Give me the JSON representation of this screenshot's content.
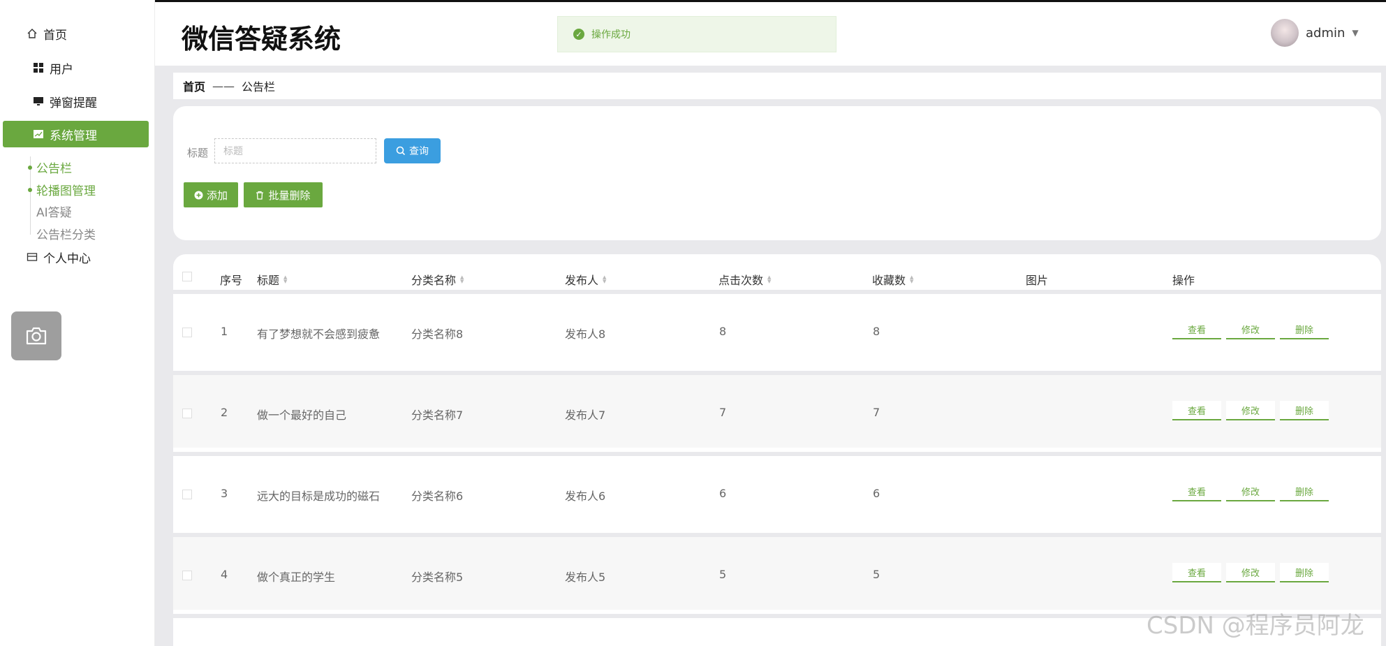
{
  "app": {
    "title": "微信答疑系统"
  },
  "toast": {
    "text": "操作成功"
  },
  "user": {
    "name": "admin"
  },
  "sidebar": {
    "items": [
      {
        "label": "首页",
        "icon": "home-icon"
      },
      {
        "label": "用户",
        "icon": "grid-icon"
      },
      {
        "label": "弹窗提醒",
        "icon": "monitor-icon"
      },
      {
        "label": "系统管理",
        "icon": "chart-icon"
      },
      {
        "label": "个人中心",
        "icon": "card-icon"
      }
    ],
    "submenu": [
      "公告栏",
      "轮播图管理",
      "AI答疑",
      "公告栏分类"
    ]
  },
  "breadcrumb": {
    "home": "首页",
    "sep": "——",
    "current": "公告栏"
  },
  "search": {
    "label": "标题",
    "placeholder": "标题",
    "button": "查询"
  },
  "actions": {
    "add": "添加",
    "bulk_delete": "批量删除"
  },
  "table": {
    "headers": [
      "序号",
      "标题",
      "分类名称",
      "发布人",
      "点击次数",
      "收藏数",
      "图片",
      "操作"
    ],
    "rows": [
      {
        "no": "1",
        "title": "有了梦想就不会感到疲惫",
        "category": "分类名称8",
        "publisher": "发布人8",
        "clicks": "8",
        "favorites": "8"
      },
      {
        "no": "2",
        "title": "做一个最好的自己",
        "category": "分类名称7",
        "publisher": "发布人7",
        "clicks": "7",
        "favorites": "7"
      },
      {
        "no": "3",
        "title": "远大的目标是成功的磁石",
        "category": "分类名称6",
        "publisher": "发布人6",
        "clicks": "6",
        "favorites": "6"
      },
      {
        "no": "4",
        "title": "做个真正的学生",
        "category": "分类名称5",
        "publisher": "发布人5",
        "clicks": "5",
        "favorites": "5"
      }
    ],
    "row_actions": {
      "view": "查看",
      "edit": "修改",
      "delete": "删除"
    }
  },
  "watermark": "CSDN @程序员阿龙",
  "colors": {
    "primary": "#6aa83f",
    "query": "#3b9ee0"
  }
}
